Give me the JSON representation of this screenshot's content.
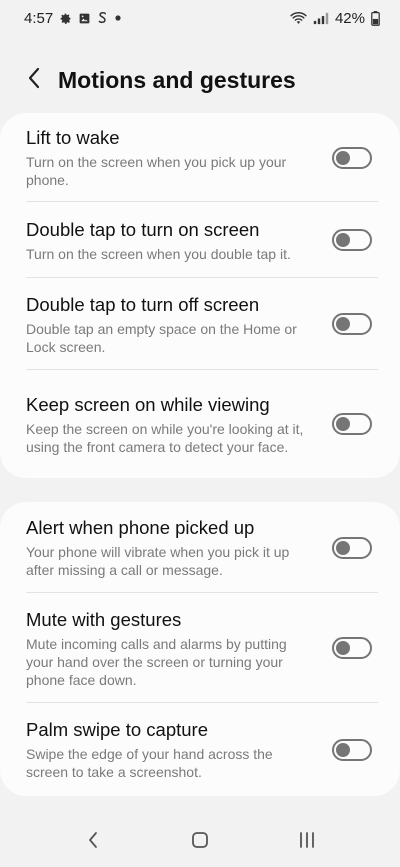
{
  "status_bar": {
    "time": "4:57",
    "battery": "42%",
    "icons": [
      "gear-icon",
      "image-icon",
      "s-icon",
      "dot-icon",
      "wifi-icon",
      "signal-icon",
      "battery-icon"
    ]
  },
  "header": {
    "title": "Motions and gestures",
    "back_icon": "back-arrow-icon"
  },
  "colors": {
    "background": "#f2f2f2",
    "card": "#fcfcfc",
    "toggle_off": "#757575",
    "subtitle": "#7a7a7a"
  },
  "group1": {
    "items": [
      {
        "title": "Lift to wake",
        "subtitle": "Turn on the screen when you pick up your phone.",
        "enabled": false
      },
      {
        "title": "Double tap to turn on screen",
        "subtitle": "Turn on the screen when you double tap it.",
        "enabled": false
      },
      {
        "title": "Double tap to turn off screen",
        "subtitle": "Double tap an empty space on the Home or Lock screen.",
        "enabled": false
      },
      {
        "title": "Keep screen on while viewing",
        "subtitle": "Keep the screen on while you're looking at it, using the front camera to detect your face.",
        "enabled": false
      }
    ]
  },
  "group2": {
    "items": [
      {
        "title": "Alert when phone picked up",
        "subtitle": "Your phone will vibrate when you pick it up after missing a call or message.",
        "enabled": false
      },
      {
        "title": "Mute with gestures",
        "subtitle": "Mute incoming calls and alarms by putting your hand over the screen or turning your phone face down.",
        "enabled": false
      },
      {
        "title": "Palm swipe to capture",
        "subtitle": "Swipe the edge of your hand across the screen to take a screenshot.",
        "enabled": false
      }
    ]
  },
  "nav_bar": {
    "icons": [
      "nav-back-icon",
      "nav-home-icon",
      "nav-recents-icon"
    ]
  }
}
